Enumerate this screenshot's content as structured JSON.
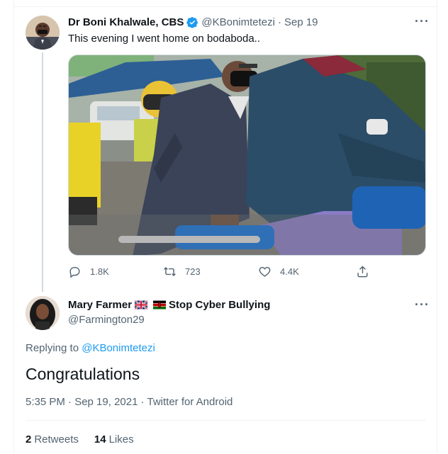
{
  "colors": {
    "accent": "#1d9bf0",
    "text": "#0f1419",
    "muted": "#536471",
    "border": "#eff3f4",
    "thread": "#cfd9de"
  },
  "tweet": {
    "author_name": "Dr Boni Khalwale, CBS",
    "handle": "@KBonimtetezi",
    "date": "Sep 19",
    "text": "This evening I went home on bodaboda..",
    "verified_icon": "verified-badge-icon",
    "actions": {
      "replies": "1.8K",
      "retweets": "723",
      "likes": "4.4K"
    }
  },
  "reply": {
    "author_name_part1": "Mary Farmer",
    "author_name_part2": "Stop Cyber Bullying",
    "handle": "@Farmington29",
    "replying_prefix": "Replying to",
    "replying_to": "@KBonimtetezi",
    "text": "Congratulations",
    "timestamp": "5:35 PM · Sep 19, 2021 · Twitter for Android",
    "retweet_count": "2",
    "retweet_label": "Retweets",
    "like_count": "14",
    "like_label": "Likes"
  }
}
